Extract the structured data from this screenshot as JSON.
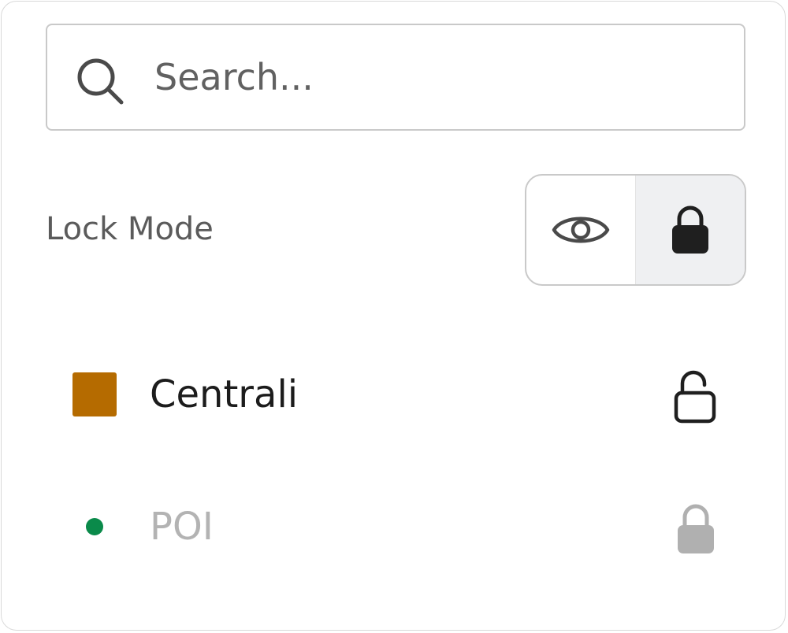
{
  "search": {
    "placeholder": "Search..."
  },
  "lock_mode": {
    "label": "Lock Mode",
    "options": [
      "view",
      "lock"
    ],
    "selected": "lock"
  },
  "layers": [
    {
      "label": "Centrali",
      "marker": "square",
      "color": "#b56b00",
      "locked": false,
      "dimmed": false
    },
    {
      "label": "POI",
      "marker": "dot",
      "color": "#0a8a4a",
      "locked": true,
      "dimmed": true
    }
  ],
  "icons": {
    "search": "search-icon",
    "eye": "eye-icon",
    "lock": "lock-icon",
    "unlock": "unlock-icon"
  },
  "colors": {
    "text_primary": "#1c1c1c",
    "text_dimmed": "#b3b3b3",
    "lock_active": "#1f1f1f",
    "lock_dimmed": "#b0b0b0",
    "segment_active_bg": "#eff0f2"
  }
}
